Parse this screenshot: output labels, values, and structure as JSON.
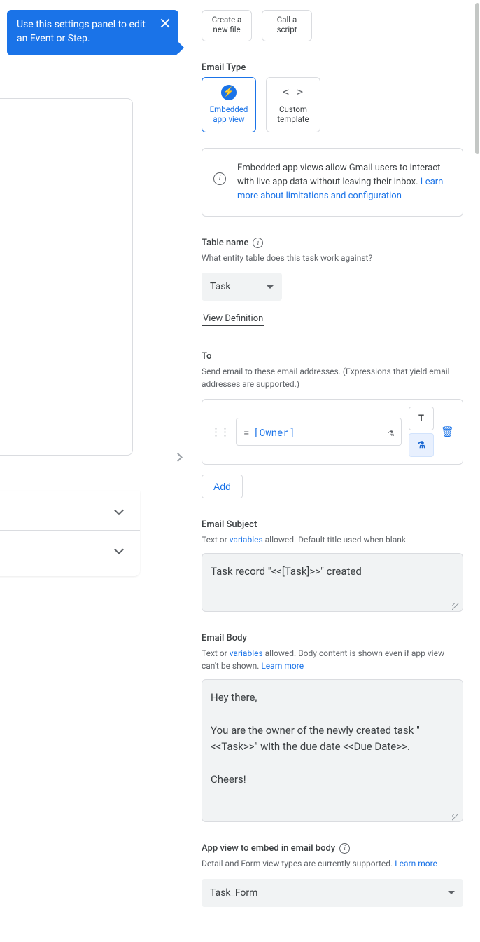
{
  "tooltip": {
    "text": "Use this settings panel to edit an Event or Step."
  },
  "top_tiles": {
    "file_line1": "Create a",
    "file_line2": "new file",
    "script_line1": "Call a",
    "script_line2": "script"
  },
  "email_type": {
    "label": "Email Type",
    "embedded_line1": "Embedded",
    "embedded_line2": "app view",
    "custom_line1": "Custom",
    "custom_line2": "template"
  },
  "info": {
    "text_a": "Embedded app views allow Gmail users to interact with live app data without leaving their inbox. ",
    "link": "Learn more about limitations and configuration"
  },
  "table": {
    "label": "Table name",
    "helper": "What entity table does this task work against?",
    "value": "Task",
    "view_def": "View Definition"
  },
  "to": {
    "label": "To",
    "helper": "Send email to these email addresses. (Expressions that yield email addresses are supported.)",
    "expr_eq": "=",
    "expr_val": "[Owner]",
    "add": "Add"
  },
  "subject": {
    "label": "Email Subject",
    "helper_a": "Text or ",
    "helper_link": "variables",
    "helper_b": " allowed. Default title used when blank.",
    "value": "Task record \"<<[Task]>>\" created"
  },
  "body": {
    "label": "Email Body",
    "helper_a": "Text or ",
    "helper_link1": "variables",
    "helper_b": " allowed. Body content is shown even if app view can't be shown. ",
    "helper_link2": "Learn more",
    "value": "Hey there,\n\nYou are the owner of the newly created task \"<<Task>>\" with the due date <<Due Date>>.\n\nCheers!"
  },
  "embed_view": {
    "label": "App view to embed in email body",
    "helper_a": "Detail and Form view types are currently supported. ",
    "helper_link": "Learn more",
    "value": "Task_Form"
  }
}
